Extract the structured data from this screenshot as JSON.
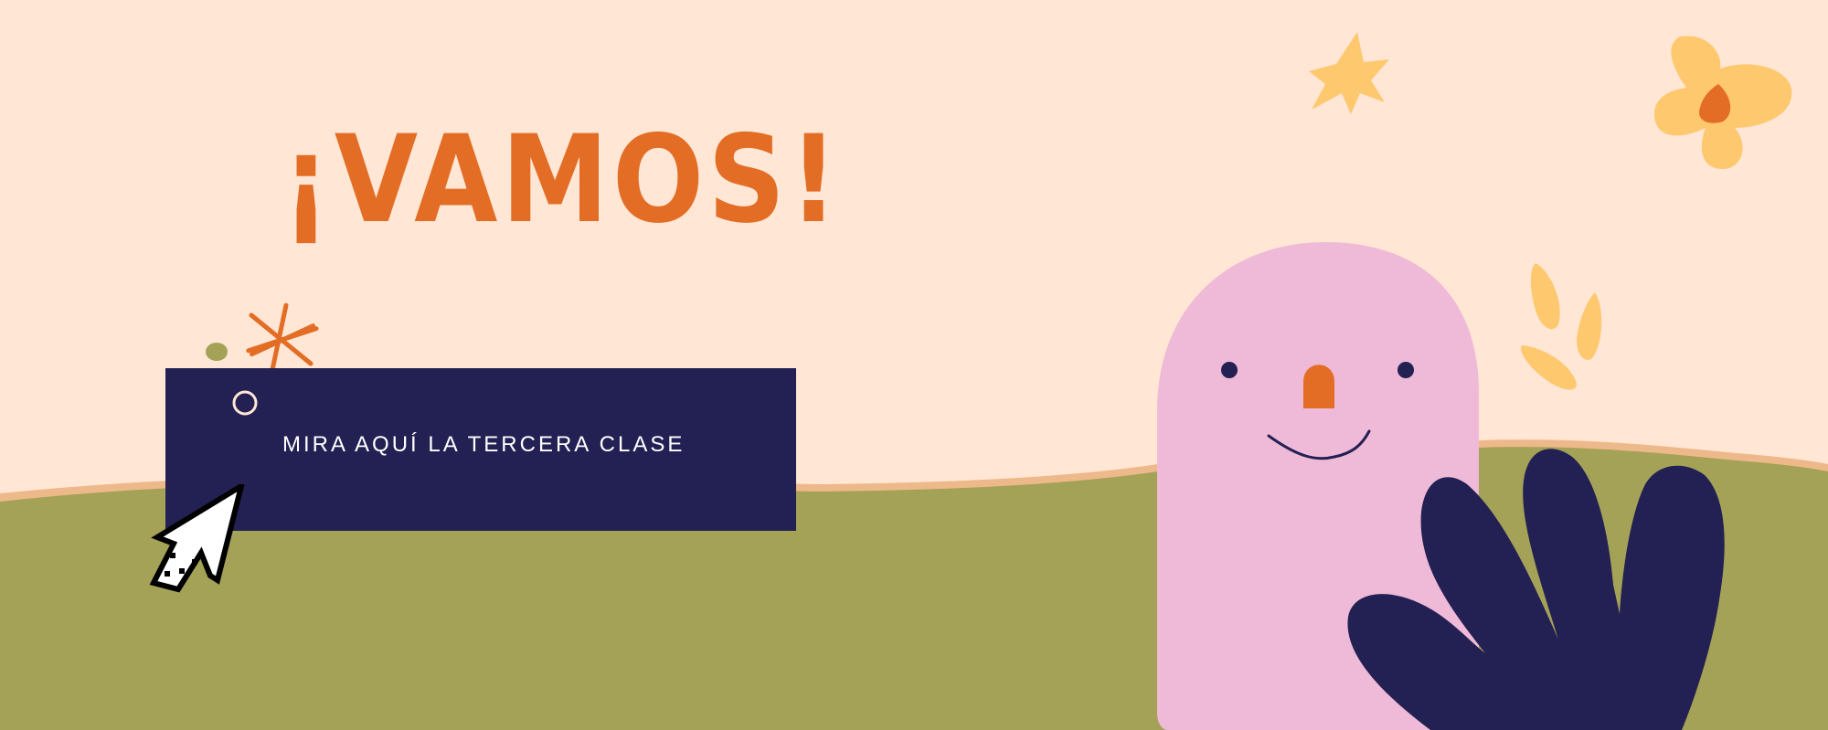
{
  "title": "¡VAMOS!",
  "cta": {
    "label": "MIRA AQUÍ LA TERCERA CLASE"
  },
  "colors": {
    "background": "#ffe6d5",
    "ground": "#a4a257",
    "ground_edge": "#eeb98a",
    "navy": "#232053",
    "orange": "#e36d24",
    "pink": "#efbad7",
    "yellow": "#fec86f"
  },
  "icons": [
    "asterisk-icon",
    "ring-icon",
    "pixel-arrow-cursor-icon",
    "star-icon",
    "flower-icon",
    "leaf-icon"
  ]
}
